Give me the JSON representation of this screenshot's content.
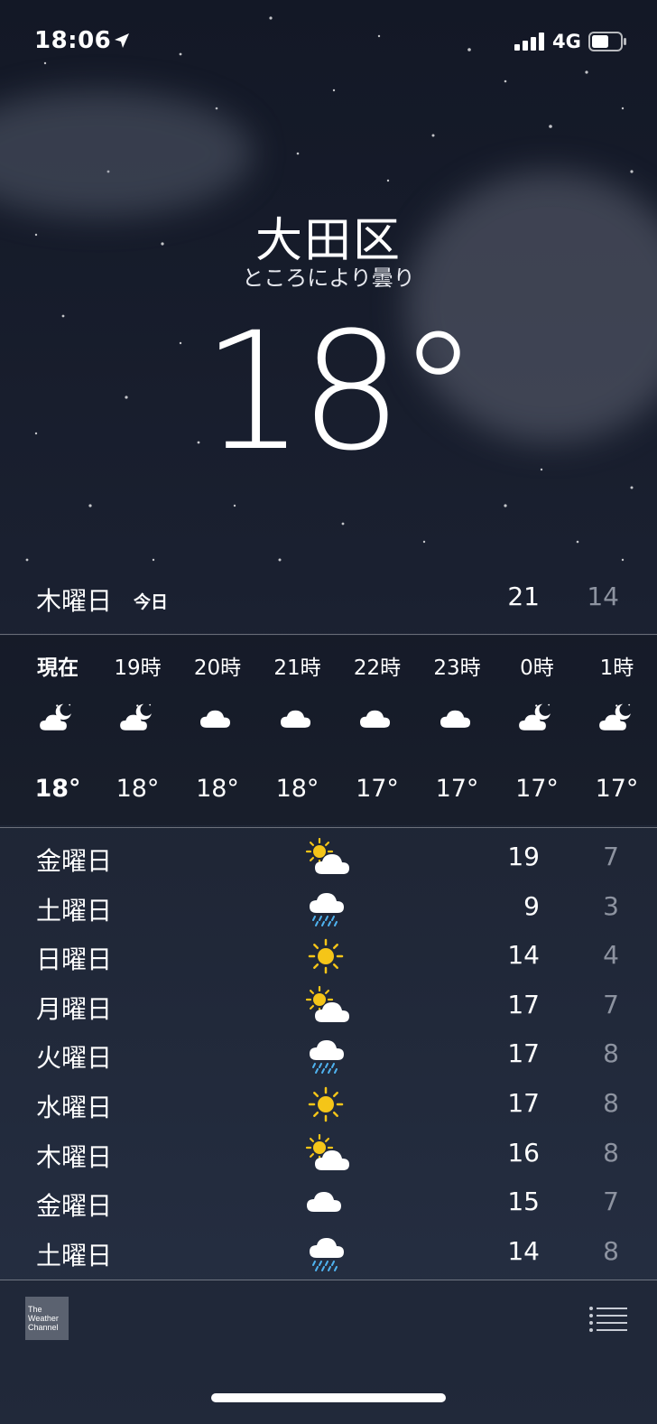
{
  "status_bar": {
    "time": "18:06",
    "network": "4G"
  },
  "header": {
    "city": "大田区",
    "condition": "ところにより曇り",
    "temperature": "18°"
  },
  "today": {
    "day": "木曜日",
    "tag": "今日",
    "high": "21",
    "low": "14"
  },
  "hourly": [
    {
      "label": "現在",
      "icon": "moon-cloud-icon",
      "temp": "18°"
    },
    {
      "label": "19時",
      "icon": "moon-cloud-icon",
      "temp": "18°"
    },
    {
      "label": "20時",
      "icon": "cloud-icon",
      "temp": "18°"
    },
    {
      "label": "21時",
      "icon": "cloud-icon",
      "temp": "18°"
    },
    {
      "label": "22時",
      "icon": "cloud-icon",
      "temp": "17°"
    },
    {
      "label": "23時",
      "icon": "cloud-icon",
      "temp": "17°"
    },
    {
      "label": "0時",
      "icon": "moon-cloud-icon",
      "temp": "17°"
    },
    {
      "label": "1時",
      "icon": "moon-cloud-icon",
      "temp": "17°"
    }
  ],
  "daily": [
    {
      "day": "金曜日",
      "icon": "sun-cloud-icon",
      "high": "19",
      "low": "7"
    },
    {
      "day": "土曜日",
      "icon": "rain-icon",
      "high": "9",
      "low": "3"
    },
    {
      "day": "日曜日",
      "icon": "sun-icon",
      "high": "14",
      "low": "4"
    },
    {
      "day": "月曜日",
      "icon": "sun-cloud-icon",
      "high": "17",
      "low": "7"
    },
    {
      "day": "火曜日",
      "icon": "rain-icon",
      "high": "17",
      "low": "8"
    },
    {
      "day": "水曜日",
      "icon": "sun-icon",
      "high": "17",
      "low": "8"
    },
    {
      "day": "木曜日",
      "icon": "sun-cloud-icon",
      "high": "16",
      "low": "8"
    },
    {
      "day": "金曜日",
      "icon": "cloud-icon",
      "high": "15",
      "low": "7"
    },
    {
      "day": "土曜日",
      "icon": "rain-icon",
      "high": "14",
      "low": "8"
    }
  ],
  "footer": {
    "logo_line1": "The",
    "logo_line2": "Weather",
    "logo_line3": "Channel"
  },
  "colors": {
    "sun": "#f5c518",
    "rain": "#4fb3f0",
    "cloud": "#ffffff",
    "low_temp": "#8d93a0"
  }
}
